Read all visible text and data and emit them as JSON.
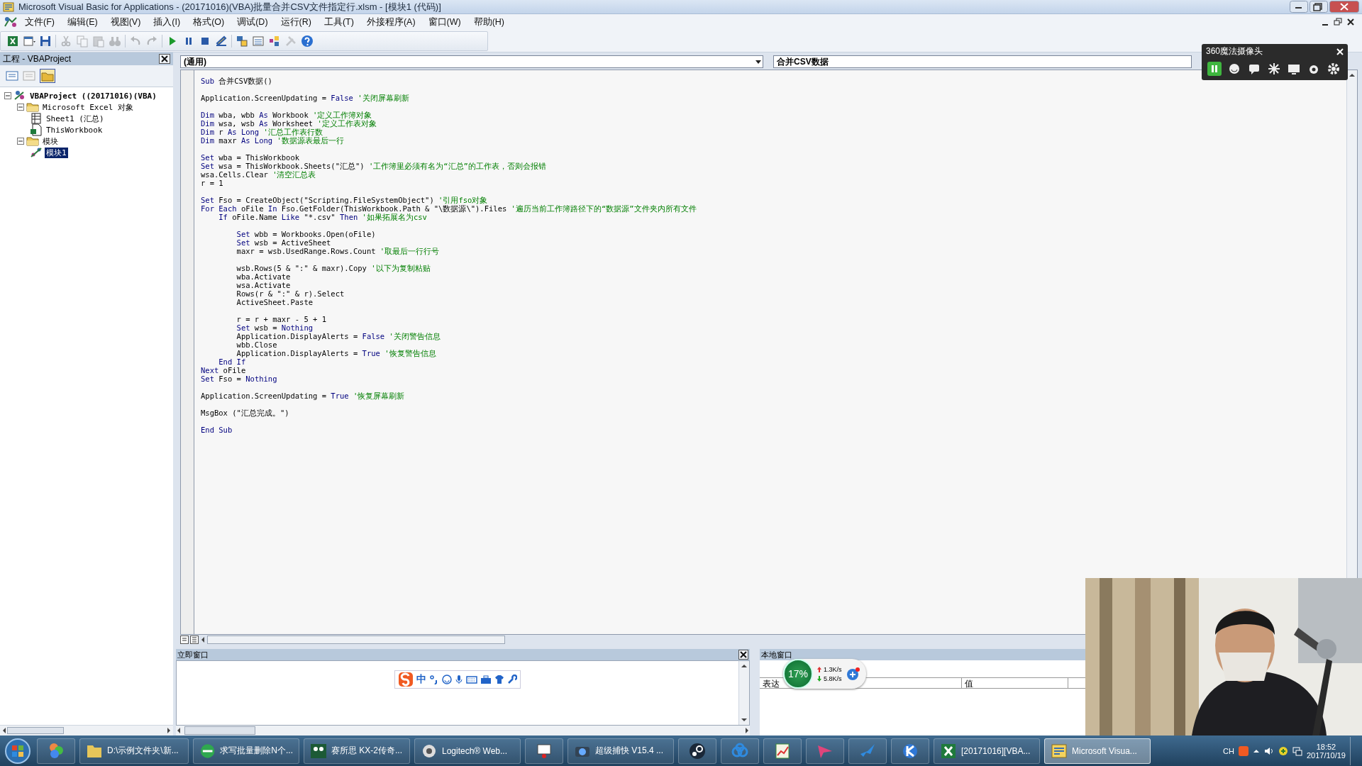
{
  "window": {
    "title": "Microsoft Visual Basic for Applications - (20171016)(VBA)批量合并CSV文件指定行.xlsm - [模块1 (代码)]"
  },
  "menu": [
    "文件(F)",
    "编辑(E)",
    "视图(V)",
    "插入(I)",
    "格式(O)",
    "调试(D)",
    "运行(R)",
    "工具(T)",
    "外接程序(A)",
    "窗口(W)",
    "帮助(H)"
  ],
  "toolbar": [
    {
      "disabled": false
    },
    {
      "disabled": false
    },
    {
      "disabled": false
    },
    {
      "disabled": true
    },
    {
      "disabled": true
    },
    {
      "disabled": true
    },
    {
      "disabled": true
    },
    {
      "disabled": true
    },
    {
      "disabled": true
    },
    {
      "disabled": false
    },
    {
      "disabled": false
    },
    {
      "disabled": false
    },
    {
      "disabled": false
    },
    {
      "disabled": false
    },
    {
      "disabled": false
    },
    {
      "disabled": false
    },
    {
      "disabled": true
    },
    {
      "disabled": false
    }
  ],
  "project_pane": {
    "title": "工程 - VBAProject",
    "tree": [
      {
        "kind": "project",
        "label": "VBAProject ((20171016)(VBA)",
        "expanded": true,
        "selected": false,
        "children": [
          {
            "kind": "folder",
            "label": "Microsoft Excel 对象",
            "expanded": true,
            "selected": false,
            "children": [
              {
                "kind": "sheet",
                "label": "Sheet1 (汇总)",
                "selected": false
              },
              {
                "kind": "workbook",
                "label": "ThisWorkbook",
                "selected": false
              }
            ]
          },
          {
            "kind": "folder",
            "label": "模块",
            "expanded": true,
            "selected": false,
            "children": [
              {
                "kind": "module",
                "label": "模块1",
                "selected": true
              }
            ]
          }
        ]
      }
    ]
  },
  "code_window": {
    "object_box": "(通用)",
    "procedure_box": "合并CSV数据",
    "lines": [
      {
        "kind": "code",
        "parts": [
          {
            "kind": "keyword",
            "text": "Sub"
          },
          {
            "kind": "plain",
            "text": " 合并CSV数据()"
          }
        ]
      },
      {
        "kind": "blank"
      },
      {
        "kind": "code",
        "parts": [
          {
            "kind": "plain",
            "text": "Application.ScreenUpdating = "
          },
          {
            "kind": "keyword",
            "text": "False"
          },
          {
            "kind": "comment",
            "text": " '关闭屏幕刷新"
          }
        ]
      },
      {
        "kind": "blank"
      },
      {
        "kind": "code",
        "parts": [
          {
            "kind": "keyword",
            "text": "Dim"
          },
          {
            "kind": "plain",
            "text": " wba, wbb "
          },
          {
            "kind": "keyword",
            "text": "As"
          },
          {
            "kind": "plain",
            "text": " Workbook"
          },
          {
            "kind": "comment",
            "text": " '定义工作簿对象"
          }
        ]
      },
      {
        "kind": "code",
        "parts": [
          {
            "kind": "keyword",
            "text": "Dim"
          },
          {
            "kind": "plain",
            "text": " wsa, wsb "
          },
          {
            "kind": "keyword",
            "text": "As"
          },
          {
            "kind": "plain",
            "text": " Worksheet"
          },
          {
            "kind": "comment",
            "text": " '定义工作表对象"
          }
        ]
      },
      {
        "kind": "code",
        "parts": [
          {
            "kind": "keyword",
            "text": "Dim"
          },
          {
            "kind": "plain",
            "text": " r "
          },
          {
            "kind": "keyword",
            "text": "As Long"
          },
          {
            "kind": "comment",
            "text": " '汇总工作表行数"
          }
        ]
      },
      {
        "kind": "code",
        "parts": [
          {
            "kind": "keyword",
            "text": "Dim"
          },
          {
            "kind": "plain",
            "text": " maxr "
          },
          {
            "kind": "keyword",
            "text": "As Long"
          },
          {
            "kind": "comment",
            "text": " '数据源表最后一行"
          }
        ]
      },
      {
        "kind": "blank"
      },
      {
        "kind": "code",
        "parts": [
          {
            "kind": "keyword",
            "text": "Set"
          },
          {
            "kind": "plain",
            "text": " wba = ThisWorkbook"
          }
        ]
      },
      {
        "kind": "code",
        "parts": [
          {
            "kind": "keyword",
            "text": "Set"
          },
          {
            "kind": "plain",
            "text": " wsa = ThisWorkbook.Sheets(\"汇总\")"
          },
          {
            "kind": "comment",
            "text": " '工作簿里必须有名为“汇总”的工作表，否则会报错"
          }
        ]
      },
      {
        "kind": "code",
        "parts": [
          {
            "kind": "plain",
            "text": "wsa.Cells.Clear"
          },
          {
            "kind": "comment",
            "text": " '清空汇总表"
          }
        ]
      },
      {
        "kind": "code",
        "parts": [
          {
            "kind": "plain",
            "text": "r = 1"
          }
        ]
      },
      {
        "kind": "blank"
      },
      {
        "kind": "code",
        "parts": [
          {
            "kind": "keyword",
            "text": "Set"
          },
          {
            "kind": "plain",
            "text": " Fso = CreateObject(\"Scripting.FileSystemObject\")"
          },
          {
            "kind": "comment",
            "text": " '引用fso对象"
          }
        ]
      },
      {
        "kind": "code",
        "parts": [
          {
            "kind": "keyword",
            "text": "For Each"
          },
          {
            "kind": "plain",
            "text": " oFile "
          },
          {
            "kind": "keyword",
            "text": "In"
          },
          {
            "kind": "plain",
            "text": " Fso.GetFolder(ThisWorkbook.Path & \"\\数据源\\\").Files"
          },
          {
            "kind": "comment",
            "text": " '遍历当前工作簿路径下的“数据源”文件夹内所有文件"
          }
        ]
      },
      {
        "kind": "code",
        "parts": [
          {
            "kind": "keyword",
            "text": "    If"
          },
          {
            "kind": "plain",
            "text": " oFile.Name "
          },
          {
            "kind": "keyword",
            "text": "Like"
          },
          {
            "kind": "plain",
            "text": " \"*.csv\" "
          },
          {
            "kind": "keyword",
            "text": "Then"
          },
          {
            "kind": "comment",
            "text": " '如果拓展名为csv"
          }
        ]
      },
      {
        "kind": "blank"
      },
      {
        "kind": "code",
        "parts": [
          {
            "kind": "keyword",
            "text": "        Set"
          },
          {
            "kind": "plain",
            "text": " wbb = Workbooks.Open(oFile)"
          }
        ]
      },
      {
        "kind": "code",
        "parts": [
          {
            "kind": "keyword",
            "text": "        Set"
          },
          {
            "kind": "plain",
            "text": " wsb = ActiveSheet"
          }
        ]
      },
      {
        "kind": "code",
        "parts": [
          {
            "kind": "plain",
            "text": "        maxr = wsb.UsedRange.Rows.Count"
          },
          {
            "kind": "comment",
            "text": " '取最后一行行号"
          }
        ]
      },
      {
        "kind": "blank"
      },
      {
        "kind": "code",
        "parts": [
          {
            "kind": "plain",
            "text": "        wsb.Rows(5 & \":\" & maxr).Copy"
          },
          {
            "kind": "comment",
            "text": " '以下为复制粘贴"
          }
        ]
      },
      {
        "kind": "code",
        "parts": [
          {
            "kind": "plain",
            "text": "        wba.Activate"
          }
        ]
      },
      {
        "kind": "code",
        "parts": [
          {
            "kind": "plain",
            "text": "        wsa.Activate"
          }
        ]
      },
      {
        "kind": "code",
        "parts": [
          {
            "kind": "plain",
            "text": "        Rows(r & \":\" & r).Select"
          }
        ]
      },
      {
        "kind": "code",
        "parts": [
          {
            "kind": "plain",
            "text": "        ActiveSheet.Paste"
          }
        ]
      },
      {
        "kind": "blank"
      },
      {
        "kind": "code",
        "parts": [
          {
            "kind": "plain",
            "text": "        r = r + maxr - 5 + 1"
          }
        ]
      },
      {
        "kind": "code",
        "parts": [
          {
            "kind": "keyword",
            "text": "        Set"
          },
          {
            "kind": "plain",
            "text": " wsb = "
          },
          {
            "kind": "keyword",
            "text": "Nothing"
          }
        ]
      },
      {
        "kind": "code",
        "parts": [
          {
            "kind": "plain",
            "text": "        Application.DisplayAlerts = "
          },
          {
            "kind": "keyword",
            "text": "False"
          },
          {
            "kind": "comment",
            "text": " '关闭警告信息"
          }
        ]
      },
      {
        "kind": "code",
        "parts": [
          {
            "kind": "plain",
            "text": "        wbb.Close"
          }
        ]
      },
      {
        "kind": "code",
        "parts": [
          {
            "kind": "plain",
            "text": "        Application.DisplayAlerts = "
          },
          {
            "kind": "keyword",
            "text": "True"
          },
          {
            "kind": "comment",
            "text": " '恢复警告信息"
          }
        ]
      },
      {
        "kind": "code",
        "parts": [
          {
            "kind": "keyword",
            "text": "    End If"
          }
        ]
      },
      {
        "kind": "code",
        "parts": [
          {
            "kind": "keyword",
            "text": "Next"
          },
          {
            "kind": "plain",
            "text": " oFile"
          }
        ]
      },
      {
        "kind": "code",
        "parts": [
          {
            "kind": "keyword",
            "text": "Set"
          },
          {
            "kind": "plain",
            "text": " Fso = "
          },
          {
            "kind": "keyword",
            "text": "Nothing"
          }
        ]
      },
      {
        "kind": "blank"
      },
      {
        "kind": "code",
        "parts": [
          {
            "kind": "plain",
            "text": "Application.ScreenUpdating = "
          },
          {
            "kind": "keyword",
            "text": "True"
          },
          {
            "kind": "comment",
            "text": " '恢复屏幕刷新"
          }
        ]
      },
      {
        "kind": "blank"
      },
      {
        "kind": "code",
        "parts": [
          {
            "kind": "plain",
            "text": "MsgBox (\"汇总完成。\")"
          }
        ]
      },
      {
        "kind": "blank"
      },
      {
        "kind": "code",
        "parts": [
          {
            "kind": "keyword",
            "text": "End Sub"
          }
        ]
      }
    ]
  },
  "immediate_window": {
    "title": "立即窗口"
  },
  "locals_window": {
    "title": "本地窗口",
    "columns": [
      "表达",
      "值"
    ]
  },
  "ime_toolbar": {
    "mode": "中"
  },
  "network_widget": {
    "load": "17%",
    "upload": "1.3K/s",
    "download": "5.8K/s"
  },
  "camera_widget": {
    "title": "360魔法摄像头"
  },
  "taskbar": {
    "items": [
      {
        "kind": "start"
      },
      {
        "kind": "icon",
        "selected": false
      },
      {
        "kind": "app",
        "label": "D:\\示例文件夹\\新...",
        "selected": false
      },
      {
        "kind": "app",
        "label": "求写批量删除N个...",
        "selected": false
      },
      {
        "kind": "app",
        "label": "赛所思 KX-2传奇...",
        "selected": false
      },
      {
        "kind": "app",
        "label": "Logitech® Web...",
        "selected": false
      },
      {
        "kind": "icon",
        "selected": false
      },
      {
        "kind": "app",
        "label": "超级捕快 V15.4 ...",
        "selected": false
      },
      {
        "kind": "icon",
        "selected": false
      },
      {
        "kind": "icon",
        "selected": false
      },
      {
        "kind": "icon",
        "selected": false
      },
      {
        "kind": "icon",
        "selected": false
      },
      {
        "kind": "icon",
        "selected": false
      },
      {
        "kind": "icon",
        "selected": false
      },
      {
        "kind": "app",
        "label": "[20171016][VBA...",
        "selected": false
      },
      {
        "kind": "app",
        "label": "Microsoft Visua...",
        "selected": true
      }
    ],
    "language": "CH",
    "time": "18:52",
    "date": "2017/10/19"
  }
}
